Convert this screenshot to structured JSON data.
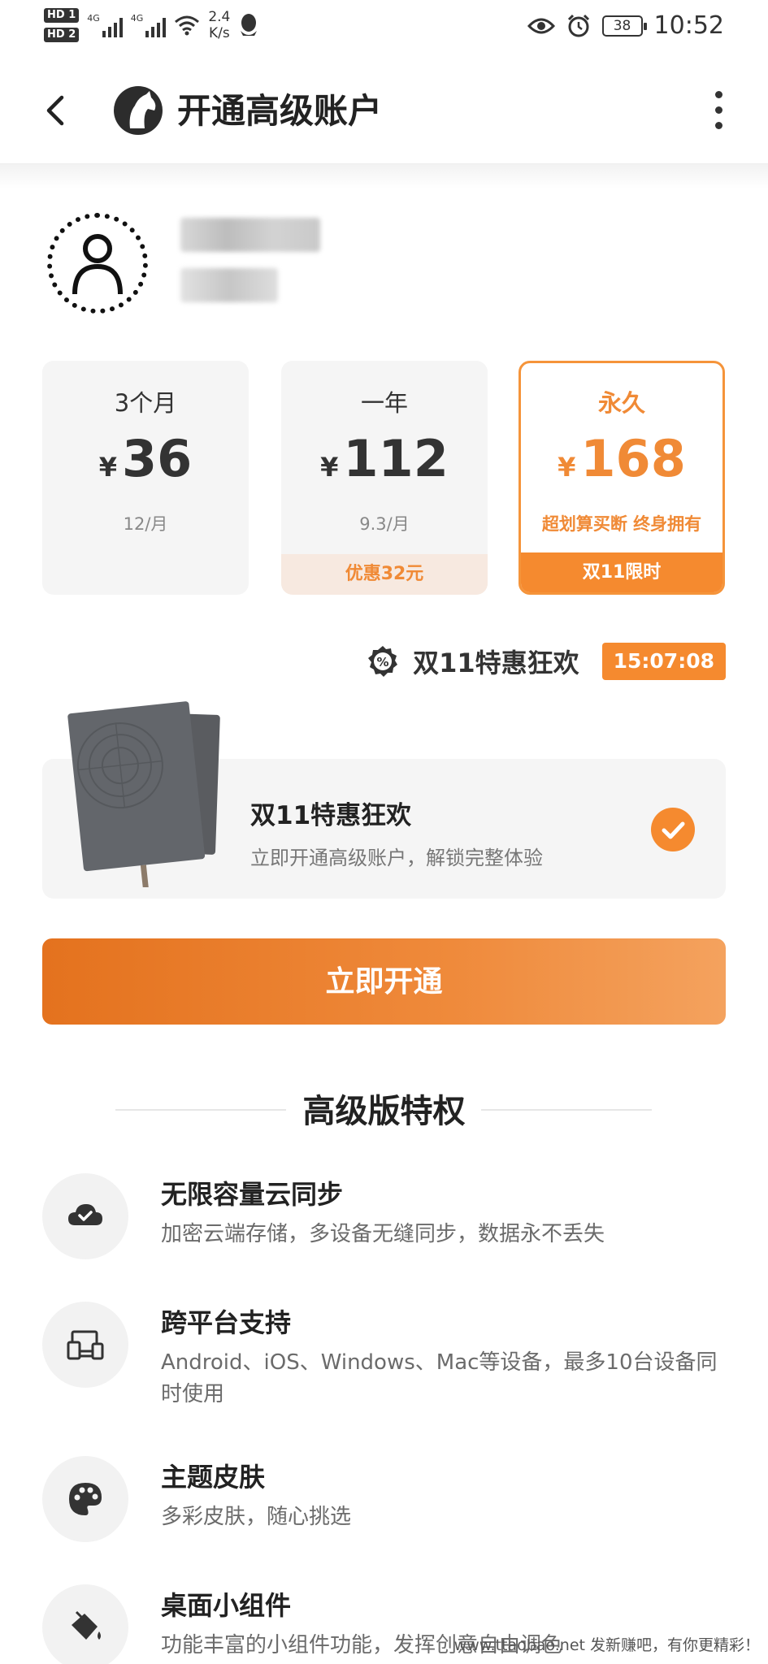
{
  "status_bar": {
    "hd1": "HD 1",
    "hd2": "HD 2",
    "net1": "4G",
    "net2": "4G",
    "speed_value": "2.4",
    "speed_unit": "K/s",
    "battery": "38",
    "time": "10:52",
    "icons": [
      "wifi-icon",
      "qq-icon",
      "eye-icon",
      "alarm-icon",
      "battery-icon"
    ]
  },
  "header": {
    "title": "开通高级账户",
    "icons": [
      "back-arrow-icon",
      "horse-logo-icon",
      "more-vertical-icon"
    ]
  },
  "plans": [
    {
      "name": "3个月",
      "currency": "¥",
      "price": "36",
      "sub": "12/月",
      "tag": ""
    },
    {
      "name": "一年",
      "currency": "¥",
      "price": "112",
      "sub": "9.3/月",
      "tag": "优惠32元"
    },
    {
      "name": "永久",
      "currency": "¥",
      "price": "168",
      "sub": "超划算买断 终身拥有",
      "tag": "双11限时",
      "selected": true
    }
  ],
  "promo": {
    "text": "双11特惠狂欢",
    "timer": "15:07:08",
    "icon": "discount-badge-icon"
  },
  "offer": {
    "title": "双11特惠狂欢",
    "desc": "立即开通高级账户，解锁完整体验",
    "checked": true
  },
  "cta": {
    "label": "立即开通"
  },
  "privileges": {
    "title": "高级版特权",
    "items": [
      {
        "title": "无限容量云同步",
        "desc": "加密云端存储，多设备无缝同步，数据永不丢失",
        "icon": "cloud-check-icon"
      },
      {
        "title": "跨平台支持",
        "desc": "Android、iOS、Windows、Mac等设备，最多10台设备同时使用",
        "icon": "devices-icon"
      },
      {
        "title": "主题皮肤",
        "desc": "多彩皮肤，随心挑选",
        "icon": "palette-icon"
      },
      {
        "title": "桌面小组件",
        "desc": "功能丰富的小组件功能，发挥创意自由调色",
        "icon": "paint-bucket-icon"
      }
    ]
  },
  "watermark": "www.ttaobao.net 发新赚吧，有你更精彩！",
  "colors": {
    "accent": "#f58a2f",
    "accent_light": "#f7e9e0",
    "card_bg": "#f5f5f5",
    "text_main": "#222222",
    "text_sub": "#777777"
  }
}
